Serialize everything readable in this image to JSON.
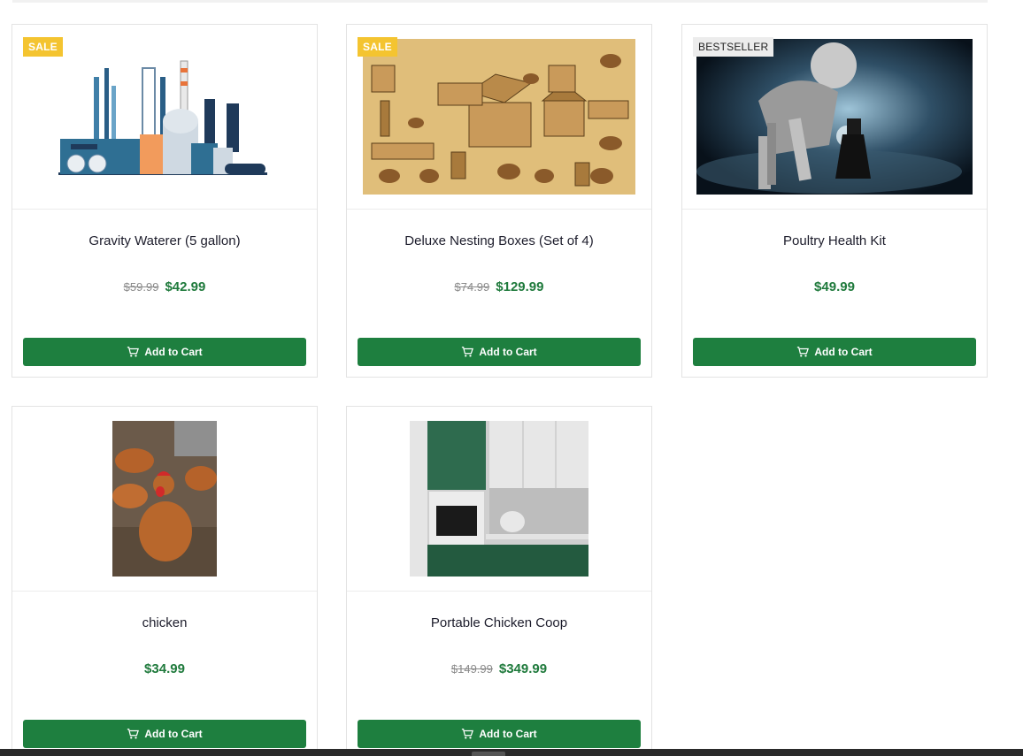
{
  "products": [
    {
      "name": "Gravity Waterer (5 gallon)",
      "badge": "SALE",
      "old_price": "$59.99",
      "price": "$42.99",
      "button": "Add to Cart",
      "image": "industrial-plant-illustration"
    },
    {
      "name": "Deluxe Nesting Boxes (Set of 4)",
      "badge": "SALE",
      "old_price": "$74.99",
      "price": "$129.99",
      "button": "Add to Cart",
      "image": "chicken-coop-sketch-on-wood"
    },
    {
      "name": "Poultry Health Kit",
      "badge": "BESTSELLER",
      "old_price": "",
      "price": "$49.99",
      "button": "Add to Cart",
      "image": "robot-and-child-with-flashlight"
    },
    {
      "name": "chicken",
      "badge": "",
      "old_price": "",
      "price": "$34.99",
      "button": "Add to Cart",
      "image": "hens-in-yard-photo"
    },
    {
      "name": "Portable Chicken Coop",
      "badge": "",
      "old_price": "$149.99",
      "price": "$349.99",
      "button": "Add to Cart",
      "image": "green-kitchen-photo"
    }
  ],
  "colors": {
    "accent_green": "#1e7f3f",
    "price_green": "#1f7a3c",
    "sale_badge": "#f4c430",
    "bestseller_badge": "#ececec"
  },
  "icons": {
    "cart": "shopping-cart-icon"
  }
}
